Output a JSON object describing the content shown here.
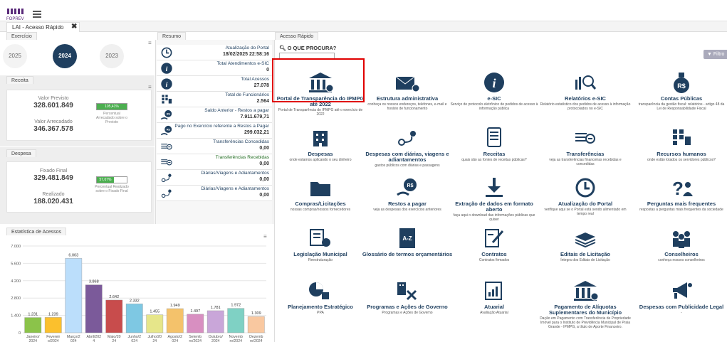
{
  "header": {
    "logo_text": "FOPREV",
    "menu_icon": "hamburger-icon"
  },
  "tabs": [
    {
      "label": "LAI - Acesso Rápido",
      "close_glyph": "✖"
    }
  ],
  "exercicio": {
    "title": "Exercício",
    "years": [
      "2025",
      "2024",
      "2023"
    ],
    "selected": "2024"
  },
  "receita": {
    "title": "Receita",
    "previsto_label": "Valor Previsto",
    "previsto_value": "328.601.849",
    "arrecadado_label": "Valor Arrecadado",
    "arrecadado_value": "346.367.578",
    "pct_label": "105,41%",
    "pct_value": 105.41,
    "pct_desc": "Percentual Arrecadado sobre o Previsto"
  },
  "despesa": {
    "title": "Despesa",
    "fixado_label": "Fixado Final",
    "fixado_value": "329.481.849",
    "realizado_label": "Realizado",
    "realizado_value": "188.020.431",
    "pct_label": "57,07%",
    "pct_value": 57.07,
    "pct_desc": "Percentual Realizado sobre o Fixado Final"
  },
  "resumo": {
    "title": "Resumo",
    "rows": [
      {
        "label": "Atualização do Portal",
        "value": "18/02/2025 22:58:16",
        "icon": "clock-icon"
      },
      {
        "label": "Total Atendimentos e-SIC",
        "value": "0",
        "icon": "info-icon"
      },
      {
        "label": "Total Acessos",
        "value": "27.078",
        "icon": "info-icon"
      },
      {
        "label": "Total de Funcionários",
        "value": "2.564",
        "icon": "org-icon"
      },
      {
        "label": "Saldo Anterior - Restos a pagar",
        "value": "7.911.679,71",
        "icon": "coins-icon"
      },
      {
        "label": "Pago no Exercício referente a Restos a Pagar",
        "value": "299.032,21",
        "icon": "coins-icon"
      },
      {
        "label": "Transferências Concedidas",
        "value": "0,00",
        "icon": "transfer-icon"
      },
      {
        "label": "Transferências Recebidas",
        "value": "0,00",
        "icon": "transfer-icon"
      },
      {
        "label": "Diárias/Viagens e Adiantamentos",
        "value": "0,00",
        "icon": "route-icon"
      },
      {
        "label": "Diárias/Viagens e Adiantamentos",
        "value": "0,00",
        "icon": "route-icon"
      }
    ]
  },
  "acesso": {
    "title": "Acesso Rápido",
    "search_label": "O QUE PROCURA?",
    "filter_label": "▼ Filtro",
    "tiles": [
      {
        "title": "Portal de Transparência do IPMPG até 2022",
        "desc": "Portal de Transparência do IPMPG até o exercício de 2022",
        "icon": "bank-icon"
      },
      {
        "title": "Estrutura administrativa",
        "desc": "conheça os nossos endereços, telefones, e-mail e horário de funcionamento",
        "icon": "mail-icon"
      },
      {
        "title": "e-SIC",
        "desc": "Serviço de protocolo eletrônico de pedidos de acesso à informação pública",
        "icon": "info-icon"
      },
      {
        "title": "Relatórios e-SIC",
        "desc": "Relatório estatístico dos pedidos de acesso à informação protocolados no e-SIC",
        "icon": "report-icon"
      },
      {
        "title": "Contas Públicas",
        "desc": "transparência da gestão fiscal: relatórios - artigo 48 da Lei de Responsabilidade Fiscal",
        "icon": "money-bag-icon"
      },
      {
        "title": "Despesas",
        "desc": "onde estamos aplicando o seu dinheiro",
        "icon": "building-icon"
      },
      {
        "title": "Despesas com diárias, viagens e adiantamentos",
        "desc": "gastos públicos com diárias e passagens",
        "icon": "route-icon"
      },
      {
        "title": "Receitas",
        "desc": "quais são as fontes de receitas públicas?",
        "icon": "receipt-icon"
      },
      {
        "title": "Transferências",
        "desc": "veja as transferências financeiras recebidas e concedidas",
        "icon": "transfer-icon"
      },
      {
        "title": "Recursos humanos",
        "desc": "onde estão lotados os servidores públicos?",
        "icon": "org-icon"
      },
      {
        "title": "Compras/Licitações",
        "desc": "nossas compras/nossos fornecedores",
        "icon": "folder-icon"
      },
      {
        "title": "Restos a pagar",
        "desc": "veja as despesas dos exercícios anteriores",
        "icon": "coins-icon"
      },
      {
        "title": "Extração de dados em formato aberto",
        "desc": "faça aqui o download das informações públicas que quiser",
        "icon": "download-icon"
      },
      {
        "title": "Atualização do Portal",
        "desc": "verifique aqui se o Portal está sendo alimentado em tempo real",
        "icon": "clock-icon"
      },
      {
        "title": "Perguntas mais frequentes",
        "desc": "respostas a perguntas mais frequentes da sociedade",
        "icon": "question-icon"
      },
      {
        "title": "Legislação Municipal",
        "desc": "Reestruturação",
        "icon": "law-icon"
      },
      {
        "title": "Glossário de termos orçamentários",
        "desc": "",
        "icon": "glossary-icon"
      },
      {
        "title": "Contratos",
        "desc": "Contratos firmados",
        "icon": "contract-icon"
      },
      {
        "title": "Editais de Licitação",
        "desc": "Íntegra dos Editais de Licitação",
        "icon": "docs-icon"
      },
      {
        "title": "Conselheiros",
        "desc": "conheça nossos conselheiros",
        "icon": "people-icon"
      },
      {
        "title": "Planejamento Estratégico",
        "desc": "PPA",
        "icon": "planning-icon"
      },
      {
        "title": "Programas e Ações de Governo",
        "desc": "Programas e Ações de Governo",
        "icon": "tools-icon"
      },
      {
        "title": "Atuarial",
        "desc": "Avaliação Atuarial",
        "icon": "chart-doc-icon"
      },
      {
        "title": "Pagamento de Alíquotas Suplementares do Município",
        "desc": "Dação em Pagamento com Transferência de Propriedade Imóvel para o Instituto de Previdência Municipal de Praia Grande - IPMPG, a título de Aporte Financeiro.",
        "icon": "bank-icon"
      },
      {
        "title": "Despesas com Publicidade Legal",
        "desc": "-",
        "icon": "megaphone-icon"
      }
    ]
  },
  "estatistica": {
    "title": "Estatística de Acessos"
  },
  "chart_data": {
    "type": "bar",
    "title": "",
    "categories": [
      "Janeiro/2024",
      "Fevereiro/2024",
      "Março/2024",
      "Abril/2024",
      "Maio/2024",
      "Junho/2024",
      "Julho/2024",
      "Agosto/2024",
      "Setembro/2024",
      "Outubro/2024",
      "Novembro/2024",
      "Dezembro/2024"
    ],
    "tick_labels": [
      [
        "Janeiro/",
        "2024"
      ],
      [
        "Fevereir",
        "o/2024"
      ],
      [
        "Março/2",
        "024"
      ],
      [
        "Abril/202",
        "4"
      ],
      [
        "Maio/20",
        "24"
      ],
      [
        "Junho/2",
        "024"
      ],
      [
        "Julho/20",
        "24"
      ],
      [
        "Agosto/2",
        "024"
      ],
      [
        "Setemb",
        "ro/2024"
      ],
      [
        "Outubro/",
        "2024"
      ],
      [
        "Novemb",
        "ro/2024"
      ],
      [
        "Dezemb",
        "ro/2024"
      ]
    ],
    "values": [
      1231,
      1239,
      6003,
      3868,
      2642,
      2332,
      1455,
      1949,
      1497,
      1781,
      1972,
      1309
    ],
    "value_labels": [
      "1.231",
      "1.239",
      "6.003",
      "3.868",
      "2.642",
      "2.332",
      "1.455",
      "1.949",
      "1.497",
      "1.781",
      "1.972",
      "1.309"
    ],
    "colors": [
      "#8bc34a",
      "#fbc02d",
      "#bbdefb",
      "#7b5a9a",
      "#c84c4c",
      "#7ec8e3",
      "#e6e68a",
      "#f4c26b",
      "#d88fc1",
      "#c9a6d9",
      "#7fd1c4",
      "#f9c8a0"
    ],
    "yticks": [
      "0",
      "1.400",
      "2.800",
      "4.200",
      "5.600",
      "7.000"
    ],
    "ylim": [
      0,
      7000
    ],
    "grid": true
  }
}
